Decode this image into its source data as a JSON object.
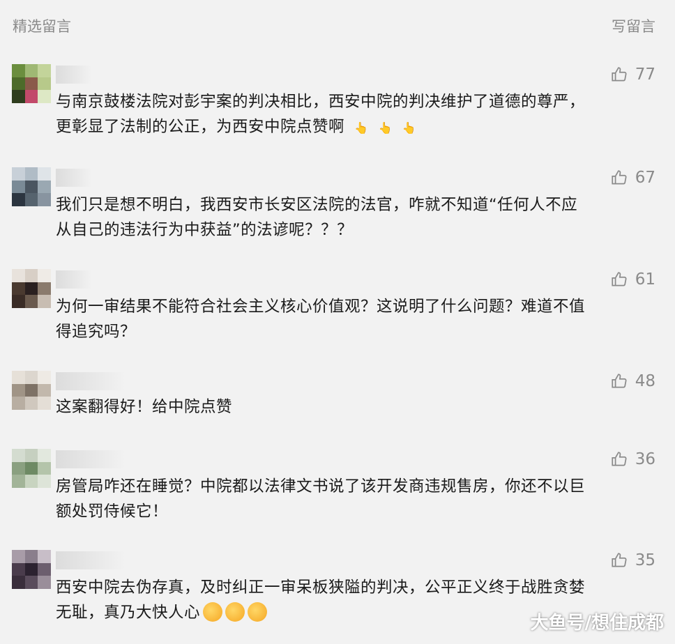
{
  "header": {
    "title": "精选留言",
    "write_label": "写留言"
  },
  "comments": [
    {
      "likes": "77",
      "text_lines": [
        "与南京鼓楼法院对彭宇案的判决相比，西安中院的判决维护了道德的尊严，",
        "更彰显了法制的公正，为西安中院点赞啊"
      ],
      "emoji": "👆"
    },
    {
      "likes": "67",
      "text_lines": [
        "我们只是想不明白，我西安市长安区法院的法官，咋就不知道“任何人不应",
        "从自己的违法行为中获益”的法谚呢？？？"
      ]
    },
    {
      "likes": "61",
      "text_lines": [
        "为何一审结果不能符合社会主义核心价值观？这说明了什么问题？难道不值",
        "得追究吗？"
      ]
    },
    {
      "likes": "48",
      "text_lines": [
        "这案翻得好！给中院点赞"
      ]
    },
    {
      "likes": "36",
      "text_lines": [
        "房管局咋还在睡觉？中院都以法律文书说了该开发商违规售房，你还不以巨",
        "额处罚侍候它！"
      ]
    },
    {
      "likes": "35",
      "text_lines": [
        "西安中院去伪存真，及时纠正一审呆板狭隘的判决，公平正义终于战胜贪婪",
        "无耻，真乃大快人心"
      ]
    }
  ],
  "watermark": "大鱼号/想住成都",
  "colors": {
    "background": "#f2f2f2",
    "muted": "#8a8a8a",
    "text": "#1a1a1a"
  },
  "icons": {
    "like": "thumbs-up-icon"
  }
}
